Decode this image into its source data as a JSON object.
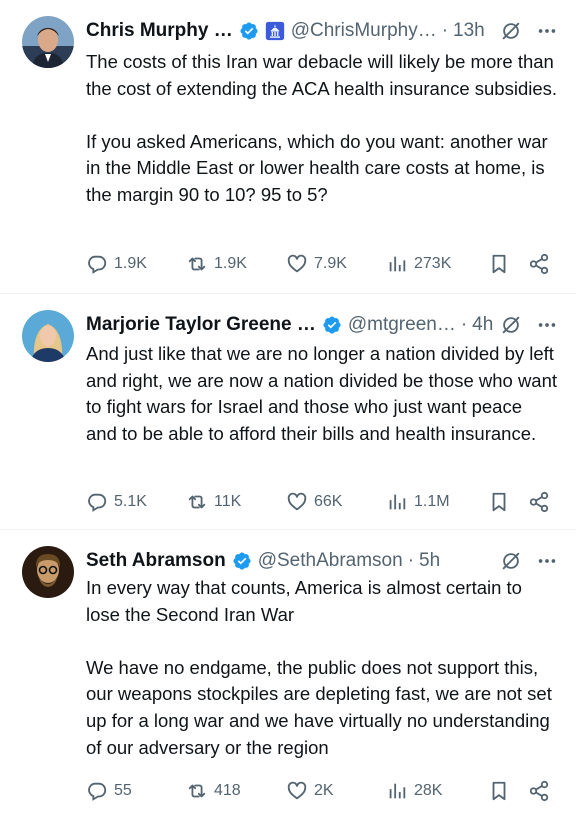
{
  "tweets": [
    {
      "name": "Chris Murphy …",
      "handle": "@ChrisMurphy…",
      "time": "13h",
      "text": "The costs of this Iran war debacle will likely be more than the cost of extending the ACA health insurance subsidies.\n\nIf you asked Americans, which do you want: another war in the Middle East or lower health care costs at home, is the margin 90 to 10? 95 to 5?",
      "replies": "1.9K",
      "reposts": "1.9K",
      "likes": "7.9K",
      "views": "273K"
    },
    {
      "name": "Marjorie Taylor Greene …",
      "handle": "@mtgreen…",
      "time": "4h",
      "text": "And just like that we are no longer a nation divided by left and right, we are now a nation divided be those who want to fight wars for Israel and those who just want peace and to be able to afford their bills and health insurance.",
      "replies": "5.1K",
      "reposts": "11K",
      "likes": "66K",
      "views": "1.1M"
    },
    {
      "name": "Seth Abramson",
      "handle": "@SethAbramson",
      "time": "5h",
      "text": "In every way that counts, America is almost certain to lose the Second Iran War\n\nWe have no endgame, the public does not support this, our weapons stockpiles are depleting fast, we are not set up for a long war and we have virtually no understanding of our adversary or the region",
      "replies": "55",
      "reposts": "418",
      "likes": "2K",
      "views": "28K"
    }
  ],
  "separator": "·",
  "colors": {
    "verified": "#1d9bf0",
    "secondary_text": "#536471",
    "primary_text": "#0f1419",
    "government_badge": "#3b5bdb"
  },
  "icons": [
    "verified-badge-icon",
    "government-building-icon",
    "grok-icon",
    "more-icon",
    "reply-icon",
    "repost-icon",
    "like-icon",
    "views-icon",
    "bookmark-icon",
    "share-icon"
  ]
}
